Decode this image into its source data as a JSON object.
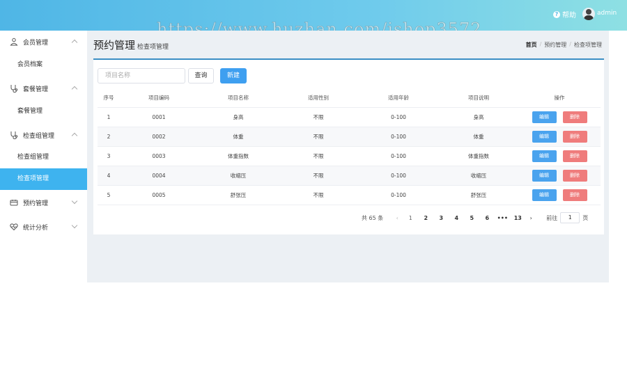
{
  "header": {
    "help_label": "帮助",
    "user_name": "admin",
    "watermark": "https://www.huzhan.com/ishop3572"
  },
  "sidebar": {
    "groups": [
      {
        "label": "会员管理",
        "icon": "user-icon",
        "expanded": true,
        "items": [
          "会员档案"
        ]
      },
      {
        "label": "套餐管理",
        "icon": "stethoscope-icon",
        "expanded": true,
        "items": [
          "套餐管理"
        ]
      },
      {
        "label": "检查组管理",
        "icon": "stethoscope-icon",
        "expanded": true,
        "items": [
          "检查组管理",
          "检查项管理"
        ]
      },
      {
        "label": "预约管理",
        "icon": "calendar-icon",
        "expanded": false,
        "items": []
      },
      {
        "label": "统计分析",
        "icon": "heart-icon",
        "expanded": false,
        "items": []
      }
    ],
    "active_item": "检查项管理"
  },
  "page": {
    "title": "预约管理",
    "subtitle": "检查项管理",
    "breadcrumb": [
      "首页",
      "预约管理",
      "检查项管理"
    ]
  },
  "toolbar": {
    "search_placeholder": "项目名称",
    "query_label": "查询",
    "new_label": "新建"
  },
  "table": {
    "columns": [
      "序号",
      "项目编码",
      "项目名称",
      "适用性别",
      "适用年龄",
      "项目说明",
      "操作"
    ],
    "rows": [
      [
        "1",
        "0001",
        "身高",
        "不限",
        "0-100",
        "身高"
      ],
      [
        "2",
        "0002",
        "体重",
        "不限",
        "0-100",
        "体重"
      ],
      [
        "3",
        "0003",
        "体重指数",
        "不限",
        "0-100",
        "体重指数"
      ],
      [
        "4",
        "0004",
        "收缩压",
        "不限",
        "0-100",
        "收缩压"
      ],
      [
        "5",
        "0005",
        "舒张压",
        "不限",
        "0-100",
        "舒张压"
      ]
    ],
    "edit_label": "编辑",
    "delete_label": "删除"
  },
  "pagination": {
    "total_label": "共 65 条",
    "pages": [
      "1",
      "2",
      "3",
      "4",
      "5",
      "6",
      "•••",
      "13"
    ],
    "current_page": "1",
    "goto_label": "前往",
    "goto_value": "1",
    "page_suffix": "页"
  },
  "colors": {
    "header_gradient_start": "#4fb6e6",
    "header_gradient_end": "#8ee0e3",
    "active_menu": "#3eb3ef",
    "primary_button": "#3e9ff0",
    "edit_button": "#4aa3ee",
    "delete_button": "#ef7c7c"
  }
}
